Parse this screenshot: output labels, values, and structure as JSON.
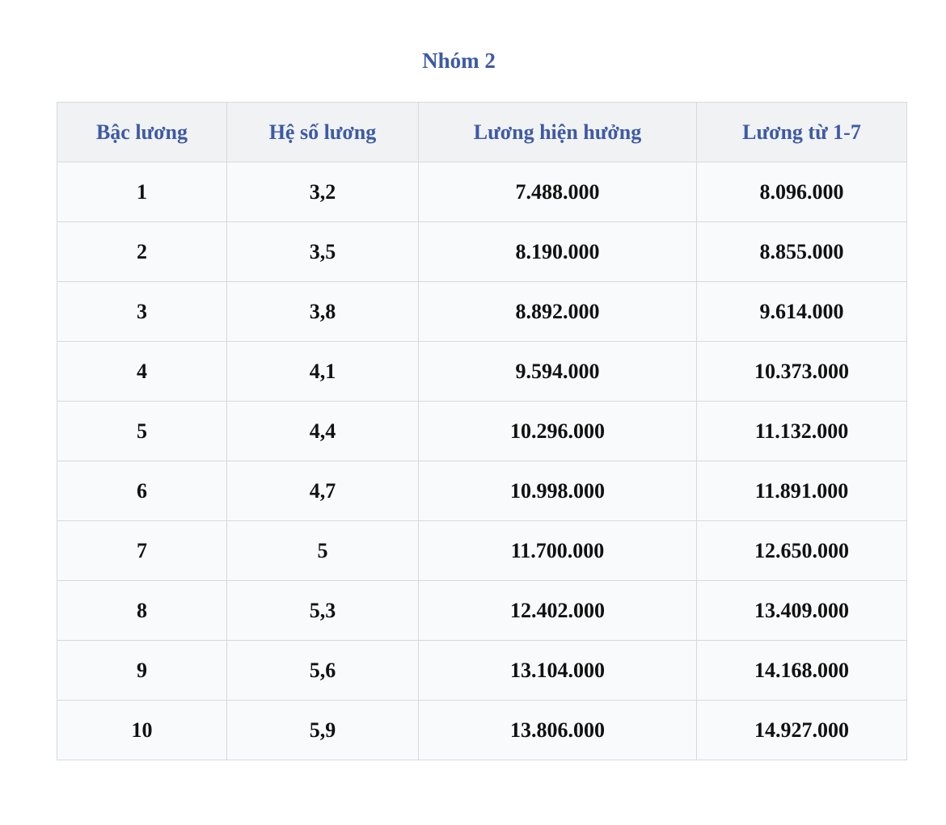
{
  "title": "Nhóm 2",
  "table": {
    "headers": [
      "Bậc lương",
      "Hệ số lương",
      "Lương hiện hưởng",
      "Lương từ 1-7"
    ],
    "rows": [
      [
        "1",
        "3,2",
        "7.488.000",
        "8.096.000"
      ],
      [
        "2",
        "3,5",
        "8.190.000",
        "8.855.000"
      ],
      [
        "3",
        "3,8",
        "8.892.000",
        "9.614.000"
      ],
      [
        "4",
        "4,1",
        "9.594.000",
        "10.373.000"
      ],
      [
        "5",
        "4,4",
        "10.296.000",
        "11.132.000"
      ],
      [
        "6",
        "4,7",
        "10.998.000",
        "11.891.000"
      ],
      [
        "7",
        "5",
        "11.700.000",
        "12.650.000"
      ],
      [
        "8",
        "5,3",
        "12.402.000",
        "13.409.000"
      ],
      [
        "9",
        "5,6",
        "13.104.000",
        "14.168.000"
      ],
      [
        "10",
        "5,9",
        "13.806.000",
        "14.927.000"
      ]
    ]
  },
  "colors": {
    "header_text": "#3d5aa6",
    "header_bg": "#f1f2f4",
    "row_bg": "#f8fafc",
    "border": "#d6d9de"
  }
}
